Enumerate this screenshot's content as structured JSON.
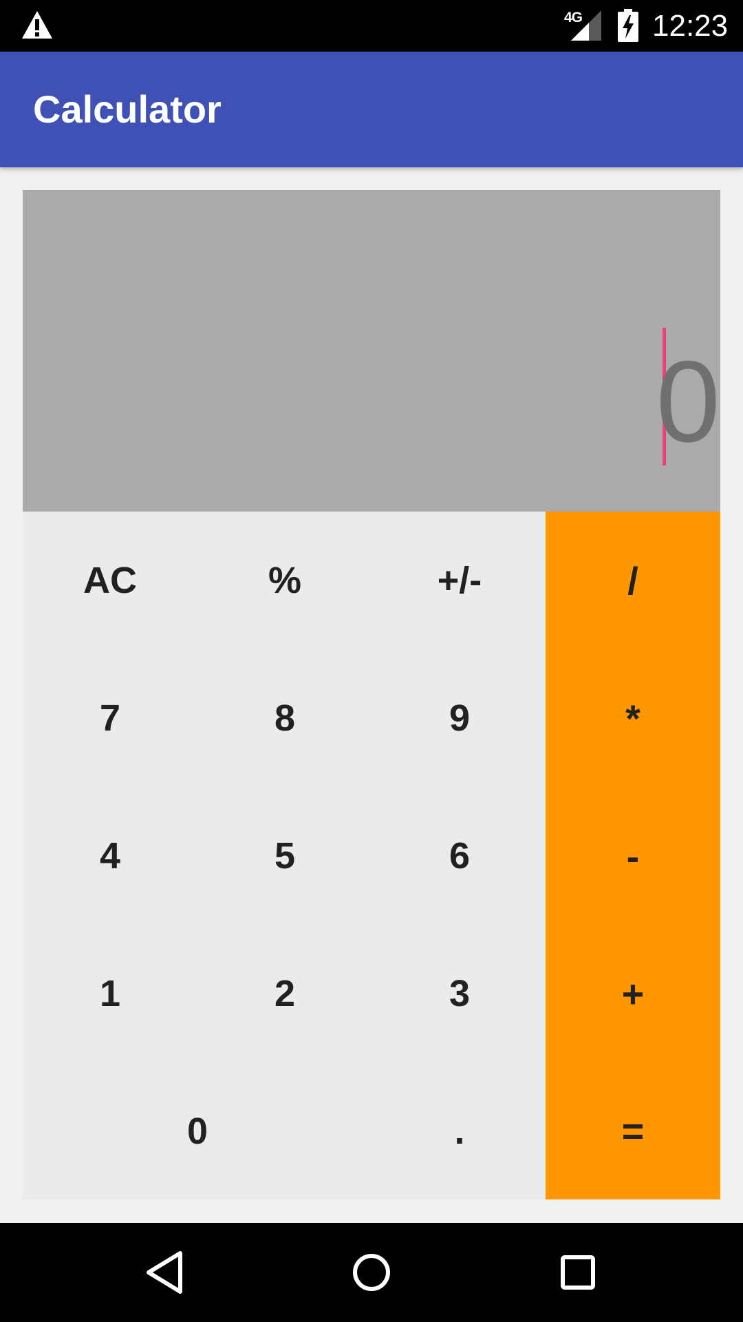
{
  "status_bar": {
    "network_type": "4G",
    "time": "12:23",
    "icons": [
      "warning-icon",
      "signal-icon",
      "battery-charging-icon"
    ]
  },
  "app_bar": {
    "title": "Calculator"
  },
  "display": {
    "value": "0"
  },
  "keypad": {
    "rows": [
      [
        "AC",
        "%",
        "+/-",
        "/"
      ],
      [
        "7",
        "8",
        "9",
        "*"
      ],
      [
        "4",
        "5",
        "6",
        "-"
      ],
      [
        "1",
        "2",
        "3",
        "+"
      ],
      [
        "0",
        ".",
        "="
      ]
    ]
  },
  "colors": {
    "app_bar": "#3f51b5",
    "display_background": "#aaaaaa",
    "display_text": "#707070",
    "caret": "#ec407a",
    "keypad_background": "#ebebeb",
    "operator_background": "#ff9800",
    "key_text": "#212121"
  },
  "nav_bar": {
    "icons": [
      "back-icon",
      "home-icon",
      "recents-icon"
    ]
  }
}
